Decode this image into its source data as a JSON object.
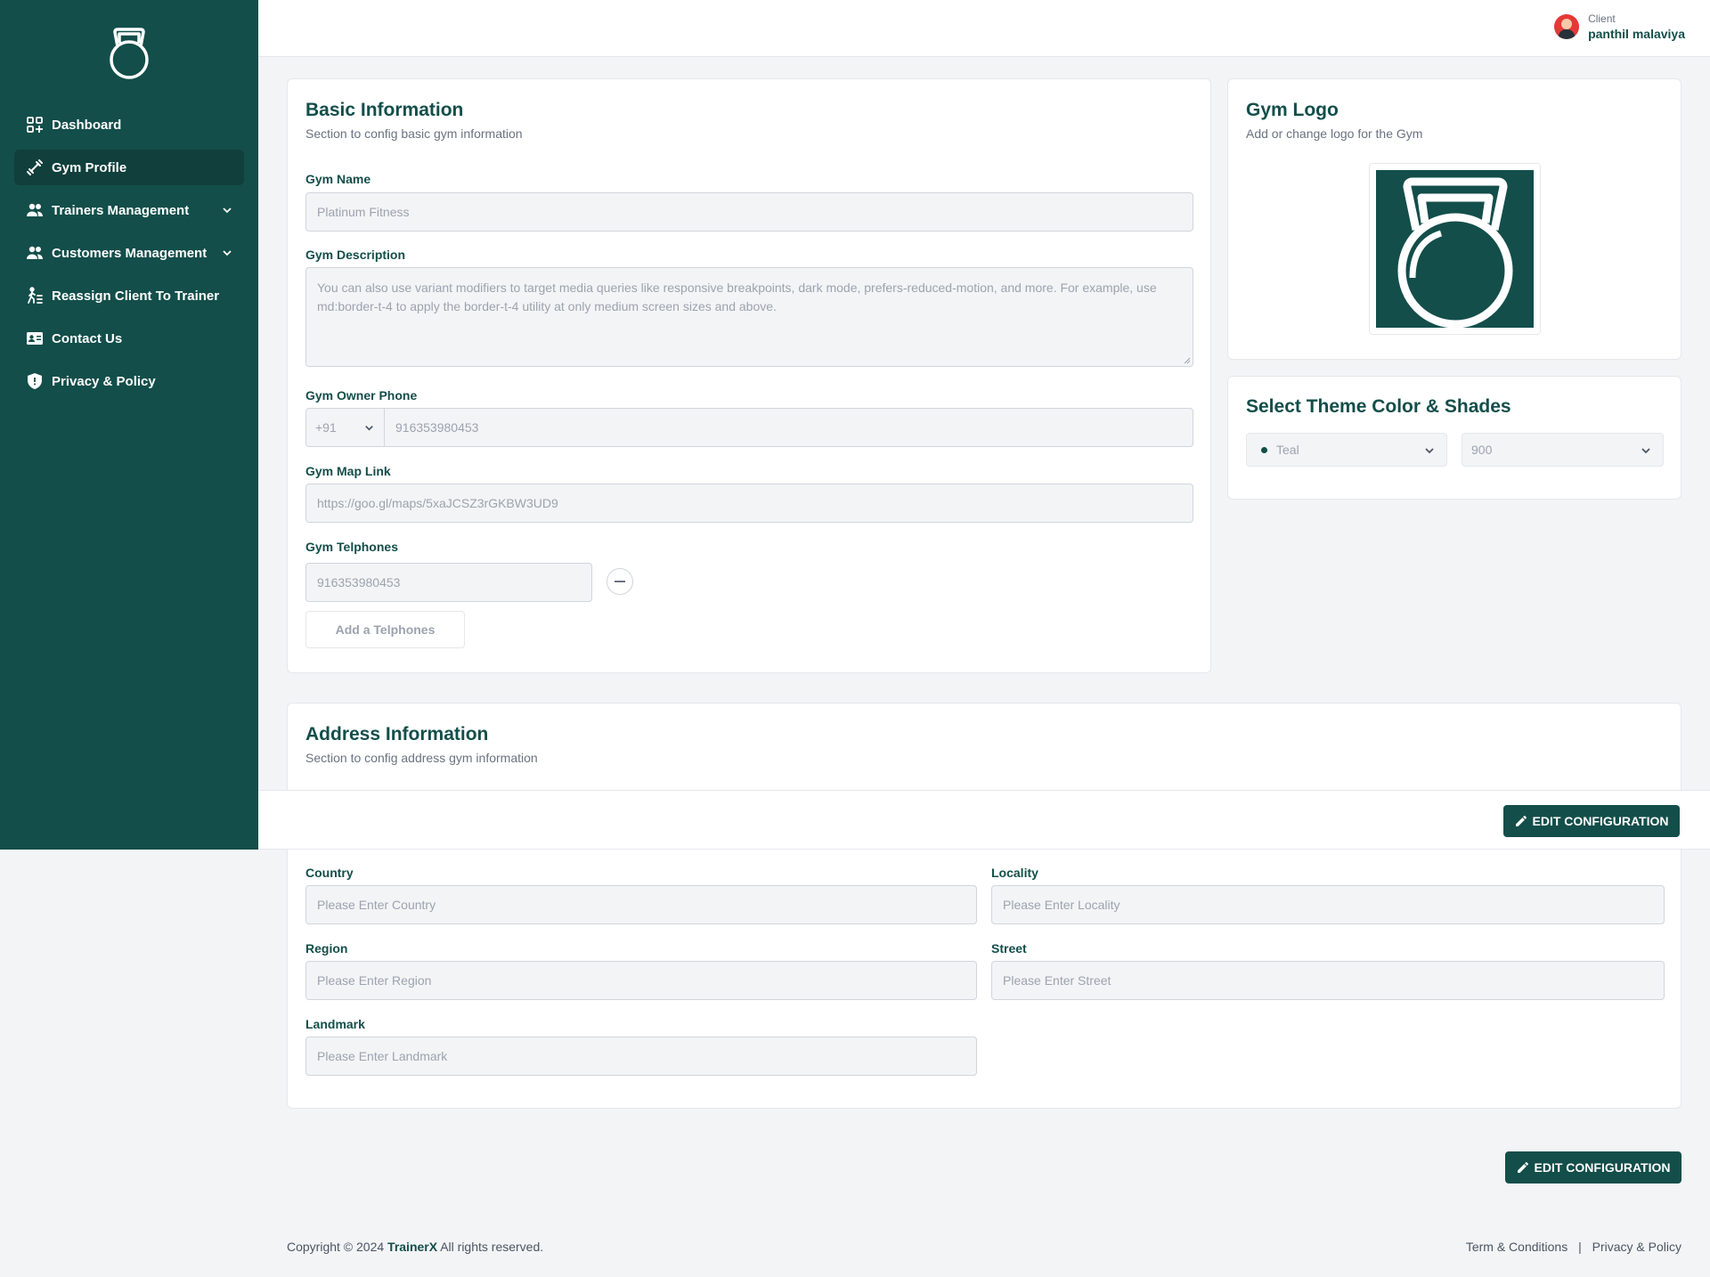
{
  "sidebar": {
    "items": [
      {
        "label": "Dashboard",
        "icon": "dashboard-icon"
      },
      {
        "label": "Gym Profile",
        "icon": "dumbbell-icon",
        "active": true
      },
      {
        "label": "Trainers Management",
        "icon": "users-icon",
        "expandable": true
      },
      {
        "label": "Customers Management",
        "icon": "users-icon",
        "expandable": true
      },
      {
        "label": "Reassign Client To Trainer",
        "icon": "person-walk-icon"
      },
      {
        "label": "Contact Us",
        "icon": "contact-card-icon"
      },
      {
        "label": "Privacy & Policy",
        "icon": "shield-icon"
      }
    ]
  },
  "header": {
    "user_role": "Client",
    "user_name": "panthil malaviya"
  },
  "basic": {
    "title": "Basic Information",
    "subtitle": "Section to config basic gym information",
    "gym_name_label": "Gym Name",
    "gym_name_value": "Platinum Fitness",
    "description_label": "Gym Description",
    "description_value": "You can also use variant modifiers to target media queries like responsive breakpoints, dark mode, prefers-reduced-motion, and more. For example, use md:border-t-4 to apply the border-t-4 utility at only medium screen sizes and above.",
    "owner_phone_label": "Gym Owner Phone",
    "owner_phone_code": "+91",
    "owner_phone_value": "916353980453",
    "map_label": "Gym Map Link",
    "map_value": "https://goo.gl/maps/5xaJCSZ3rGKBW3UD9",
    "telephones_label": "Gym Telphones",
    "telephone_value": "916353980453",
    "add_telephone_label": "Add a Telphones"
  },
  "logo": {
    "title": "Gym Logo",
    "subtitle": "Add or change logo for the Gym"
  },
  "theme": {
    "title": "Select Theme Color & Shades",
    "color_value": "Teal",
    "shade_value": "900",
    "accent_color": "#134e4a"
  },
  "address": {
    "title": "Address Information",
    "subtitle": "Section to config address gym information",
    "country_label": "Country",
    "country_placeholder": "Please Enter Country",
    "locality_label": "Locality",
    "locality_placeholder": "Please Enter Locality",
    "region_label": "Region",
    "region_placeholder": "Please Enter Region",
    "street_label": "Street",
    "street_placeholder": "Please Enter Street",
    "landmark_label": "Landmark",
    "landmark_placeholder": "Please Enter Landmark"
  },
  "actions": {
    "edit_label": "EDIT CONFIGURATION"
  },
  "footer": {
    "copyright_prefix": "Copyright © 2024",
    "brand": "TrainerX",
    "copyright_suffix": "All rights reserved.",
    "terms": "Term & Conditions",
    "separator": "|",
    "privacy": "Privacy & Policy"
  }
}
